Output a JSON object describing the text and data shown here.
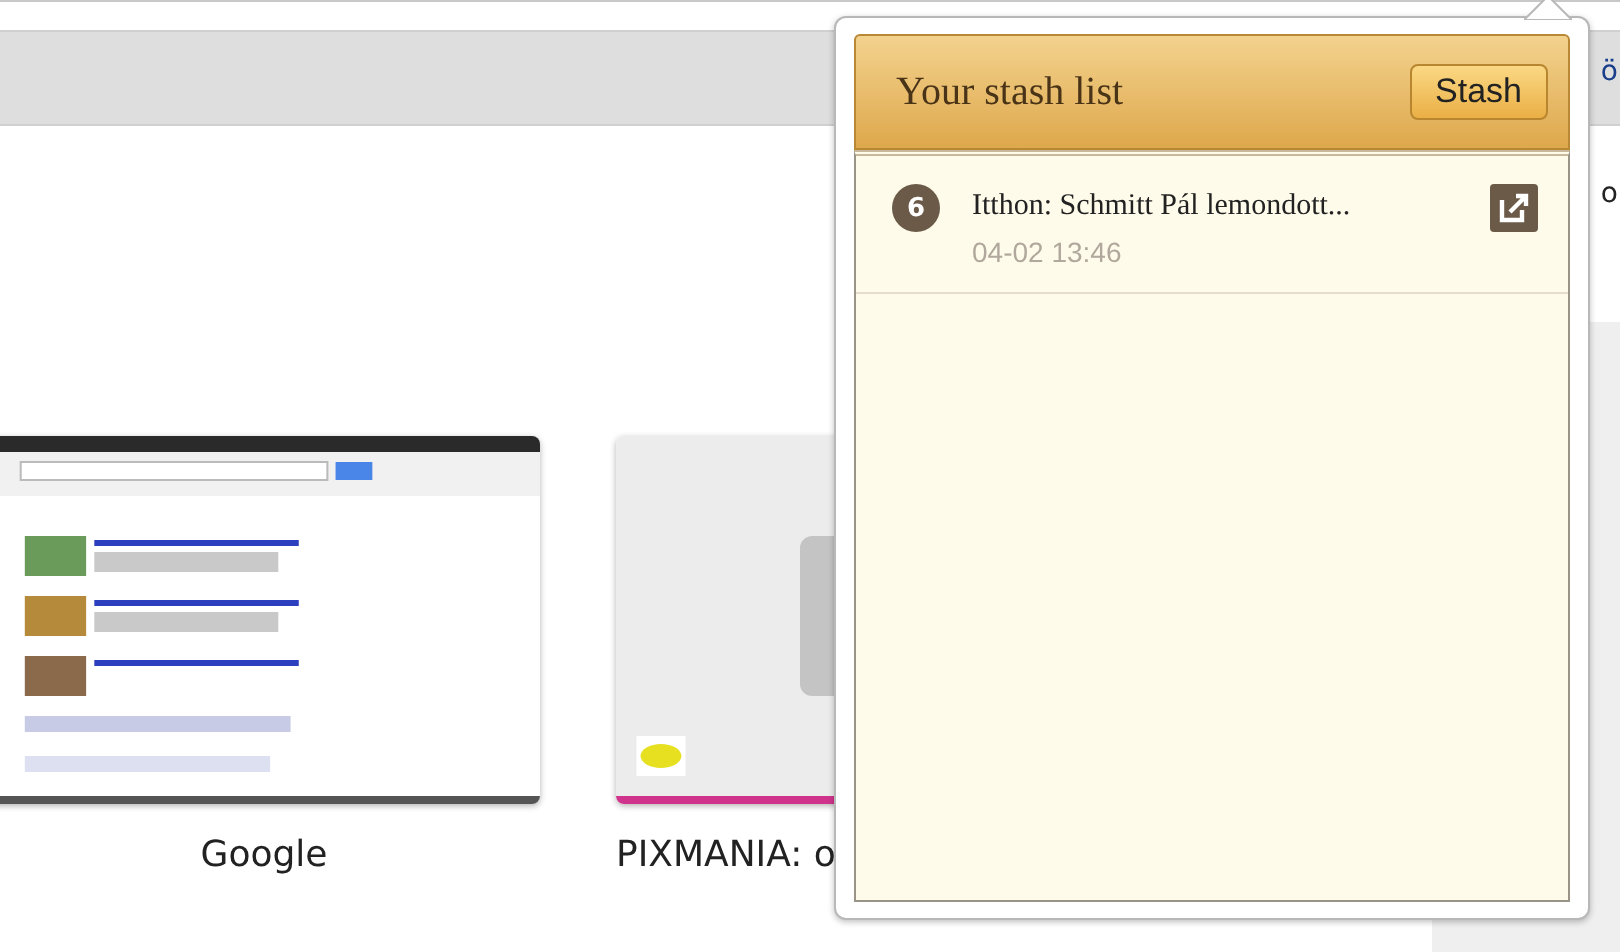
{
  "page": {
    "edge_texts": [
      "ö",
      "o"
    ],
    "thumbnails": [
      {
        "label": "Google",
        "kind": "picture",
        "color": "#555555"
      },
      {
        "label": "PIXMANIA: o",
        "kind": "picture",
        "color": "#d0338c"
      }
    ]
  },
  "stash_popup": {
    "title": "Your stash list",
    "stash_button": "Stash",
    "items": [
      {
        "number": "6",
        "title": "Itthon: Schmitt Pál lemondott...",
        "time": "04-02 13:46"
      }
    ]
  }
}
